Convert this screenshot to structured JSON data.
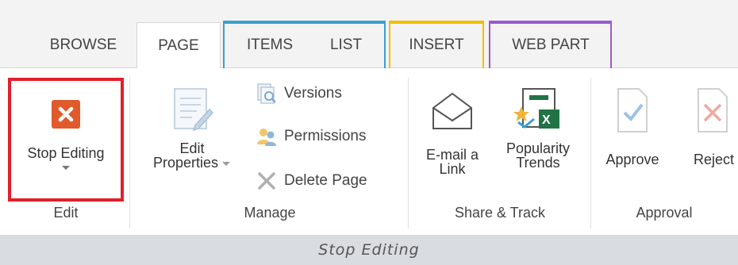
{
  "tabs": {
    "browse": "BROWSE",
    "page": "PAGE",
    "items": "ITEMS",
    "list": "LIST",
    "insert": "INSERT",
    "web_part": "WEB PART"
  },
  "colors": {
    "list_tools": "#3aa0d0",
    "insert_tools": "#f0c000",
    "web_part_tools": "#9b59d0",
    "stop_editing_icon": "#e05a2b",
    "highlight": "#e0202a"
  },
  "groups": {
    "edit": {
      "label": "Edit",
      "stop_editing": "Stop Editing"
    },
    "manage": {
      "label": "Manage",
      "edit_properties_line1": "Edit",
      "edit_properties_line2": "Properties",
      "versions": "Versions",
      "permissions": "Permissions",
      "delete_page": "Delete Page"
    },
    "share_track": {
      "label": "Share & Track",
      "email_line1": "E-mail a",
      "email_line2": "Link",
      "popularity_line1": "Popularity",
      "popularity_line2": "Trends"
    },
    "approval": {
      "label": "Approval",
      "approve": "Approve",
      "reject": "Reject"
    }
  },
  "footer": {
    "caption": "Stop Editing"
  }
}
